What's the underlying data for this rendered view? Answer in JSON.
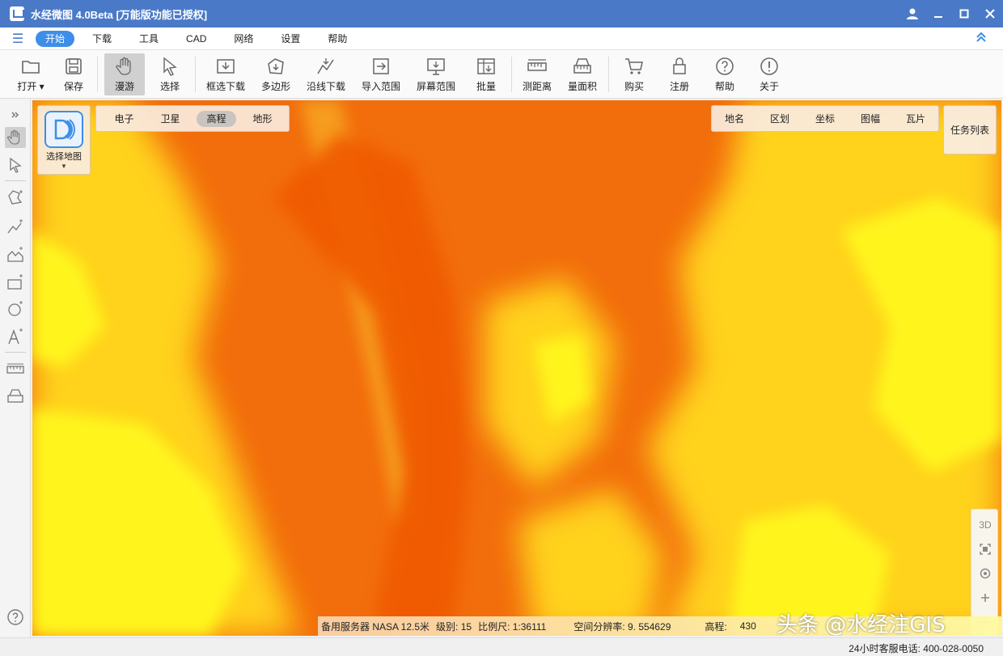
{
  "window": {
    "title": "水经微图 4.0Beta [万能版功能已授权]"
  },
  "menu": {
    "items": [
      "开始",
      "下载",
      "工具",
      "CAD",
      "网络",
      "设置",
      "帮助"
    ],
    "active": "开始"
  },
  "toolbar": {
    "open": "打开",
    "save": "保存",
    "pan": "漫游",
    "select": "选择",
    "rect_download": "框选下载",
    "polygon": "多边形",
    "line_download": "沿线下载",
    "import_range": "导入范围",
    "screen_range": "屏幕范围",
    "batch": "批量",
    "measure_distance": "测距离",
    "measure_area": "量面积",
    "buy": "购买",
    "register": "注册",
    "help": "帮助",
    "about": "关于"
  },
  "map_panel": {
    "select_map_label": "选择地图",
    "map_types": [
      "电子",
      "卫星",
      "高程",
      "地形"
    ],
    "active_map_type": "高程",
    "overlays": [
      "地名",
      "区划",
      "坐标",
      "图幅",
      "瓦片"
    ],
    "task_list": "任务列表",
    "controls": {
      "three_d": "3D"
    }
  },
  "status": {
    "server": "备用服务器 NASA 12.5米",
    "level": "级别: 15",
    "scale": "比例尺: 1:36111",
    "resolution": "空间分辨率: 9. 554629",
    "elevation": "高程:",
    "elevation_value": "430",
    "watermark": "头条 @水经注GIS",
    "phone": "24小时客服电话: 400-028-0050"
  },
  "colors": {
    "titlebar": "#4a7ac7",
    "accent": "#3d8ee8",
    "map_orange": "#f06c0a",
    "map_yellow": "#fff200"
  }
}
